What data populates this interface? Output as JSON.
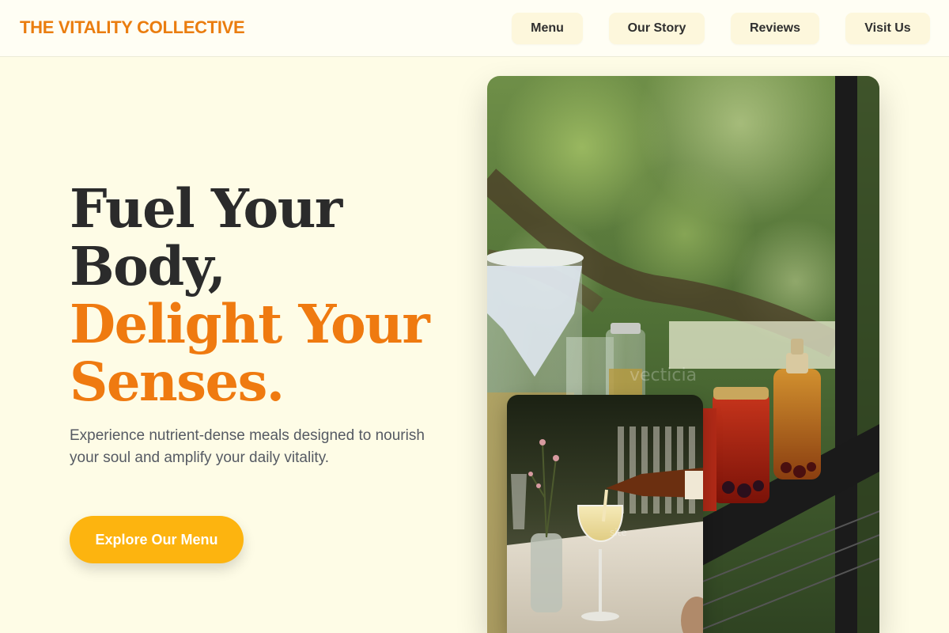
{
  "header": {
    "logo": "THE VITALITY COLLECTIVE",
    "nav": [
      {
        "label": "Menu"
      },
      {
        "label": "Our Story"
      },
      {
        "label": "Reviews"
      },
      {
        "label": "Visit Us"
      }
    ]
  },
  "hero": {
    "title_line1": "Fuel Your",
    "title_line2": "Body,",
    "title_line3": "Delight Your",
    "title_line4": "Senses.",
    "subtitle": "Experience nutrient-dense meals designed to nourish your soul and amplify your daily vitality.",
    "cta_label": "Explore Our Menu"
  },
  "colors": {
    "brand_orange": "#ea7d0f",
    "title_orange": "#ef7a10",
    "cta_yellow": "#fdb40f",
    "page_bg": "#fefce6",
    "text_dark": "#2b2b2b",
    "text_muted": "#555a63"
  },
  "images": {
    "main_photo": "jars-of-fermented-drinks-on-railing-photo",
    "inset_photo": "pouring-drink-into-wine-glass-photo"
  }
}
